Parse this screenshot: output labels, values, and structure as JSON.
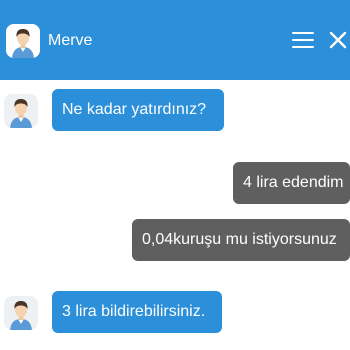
{
  "header": {
    "title": "Merve",
    "menu_icon": "hamburger-menu-icon",
    "close_icon": "close-icon",
    "background": "#2b8fd9"
  },
  "messages": [
    {
      "sender": "bot",
      "text": "Ne kadar yatırdınız?"
    },
    {
      "sender": "user",
      "text": "4 lira edendim"
    },
    {
      "sender": "user",
      "text": "0,04kuruşu mu istiyorsunuz"
    },
    {
      "sender": "bot",
      "text": "3 lira bildirebilirsiniz."
    }
  ],
  "colors": {
    "bot_bubble": "#2b8fd9",
    "user_bubble": "#5f5f5f"
  }
}
